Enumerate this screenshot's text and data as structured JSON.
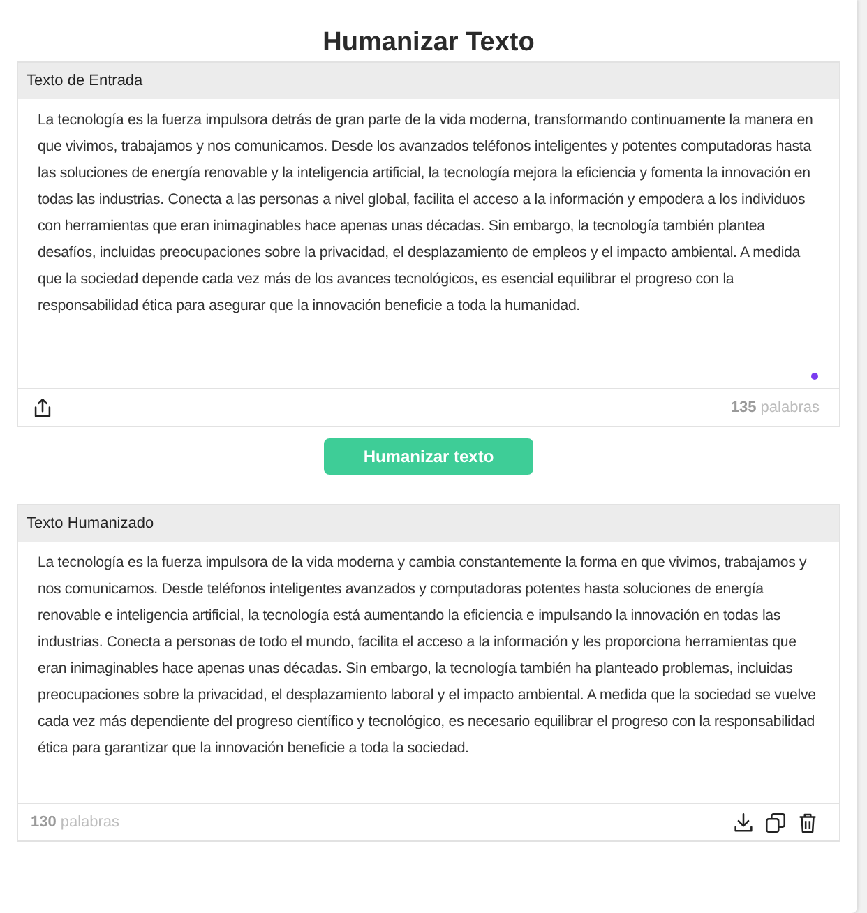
{
  "title": "Humanizar Texto",
  "input_panel": {
    "header": "Texto de Entrada",
    "text": "La tecnología es la fuerza impulsora detrás de gran parte de la vida moderna, transformando continuamente la manera en que vivimos, trabajamos y nos comunicamos. Desde los avanzados teléfonos inteligentes y potentes computadoras hasta las soluciones de energía renovable y la inteligencia artificial, la tecnología mejora la eficiencia y fomenta la innovación en todas las industrias. Conecta a las personas a nivel global, facilita el acceso a la información y empodera a los individuos con herramientas que eran inimaginables hace apenas unas décadas. Sin embargo, la tecnología también plantea desafíos, incluidas preocupaciones sobre la privacidad, el desplazamiento de empleos y el impacto ambiental. A medida que la sociedad depende cada vez más de los avances tecnológicos, es esencial equilibrar el progreso con la responsabilidad ética para asegurar que la innovación beneficie a toda la humanidad.",
    "word_count": "135",
    "word_unit": "palabras"
  },
  "action_button": "Humanizar texto",
  "output_panel": {
    "header": "Texto Humanizado",
    "text": "La tecnología es la fuerza impulsora de la vida moderna y cambia constantemente la forma en que vivimos, trabajamos y nos comunicamos. Desde teléfonos inteligentes avanzados y computadoras potentes hasta soluciones de energía renovable e inteligencia artificial, la tecnología está aumentando la eficiencia e impulsando la innovación en todas las industrias. Conecta a personas de todo el mundo, facilita el acceso a la información y les proporciona herramientas que eran inimaginables hace apenas unas décadas. Sin embargo, la tecnología también ha planteado problemas, incluidas preocupaciones sobre la privacidad, el desplazamiento laboral y el impacto ambiental. A medida que la sociedad se vuelve cada vez más dependiente del progreso científico y tecnológico, es necesario equilibrar el progreso con la responsabilidad ética para garantizar que la innovación beneficie a toda la sociedad.",
    "word_count": "130",
    "word_unit": "palabras"
  }
}
